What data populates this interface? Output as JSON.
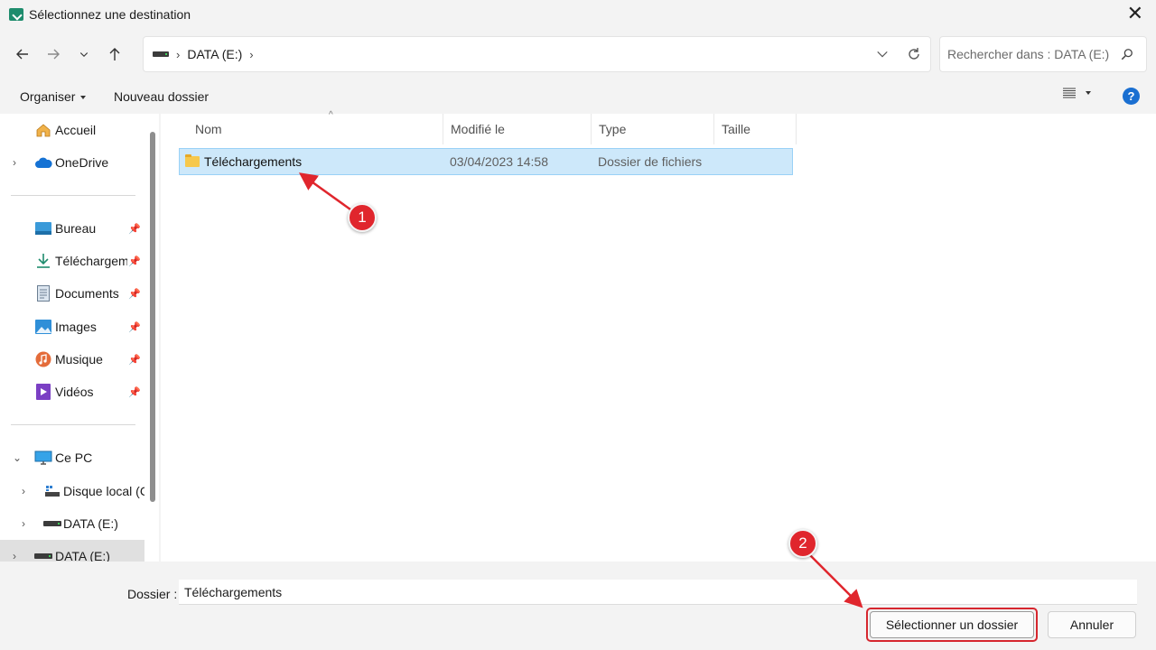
{
  "window": {
    "title": "Sélectionnez une destination",
    "close_glyph": "✕"
  },
  "nav": {
    "breadcrumb": [
      "DATA (E:)"
    ],
    "crumb_sep": "›",
    "search_placeholder": "Rechercher dans : DATA (E:)"
  },
  "commands": {
    "organiser": "Organiser",
    "new_folder": "Nouveau dossier",
    "help": "?"
  },
  "sidebar": {
    "items": [
      {
        "label": "Accueil",
        "icon": "home-icon"
      },
      {
        "label": "OneDrive",
        "icon": "cloud-icon"
      },
      {
        "label": "Bureau",
        "icon": "desktop-icon",
        "pinned": true
      },
      {
        "label": "Téléchargements",
        "icon": "download-icon",
        "pinned": true
      },
      {
        "label": "Documents",
        "icon": "documents-icon",
        "pinned": true
      },
      {
        "label": "Images",
        "icon": "images-icon",
        "pinned": true
      },
      {
        "label": "Musique",
        "icon": "music-icon",
        "pinned": true
      },
      {
        "label": "Vidéos",
        "icon": "videos-icon",
        "pinned": true
      },
      {
        "label": "Ce PC",
        "icon": "pc-icon"
      },
      {
        "label": "Disque local (C:)",
        "icon": "drive-c-icon"
      },
      {
        "label": "DATA (E:)",
        "icon": "drive-icon"
      },
      {
        "label": "DATA (E:)",
        "icon": "drive-icon",
        "selected": true
      }
    ]
  },
  "filelist": {
    "columns": [
      "Nom",
      "Modifié le",
      "Type",
      "Taille"
    ],
    "rows": [
      {
        "name": "Téléchargements",
        "modified": "03/04/2023 14:58",
        "type": "Dossier de fichiers",
        "size": ""
      }
    ]
  },
  "footer": {
    "folder_label": "Dossier :",
    "folder_value": "Téléchargements",
    "select_button": "Sélectionner un dossier",
    "cancel_button": "Annuler"
  },
  "annotations": [
    "1",
    "2"
  ],
  "colors": {
    "accent": "#1a6fd1",
    "selection": "#cde8fa",
    "annotation": "#e0262d"
  }
}
